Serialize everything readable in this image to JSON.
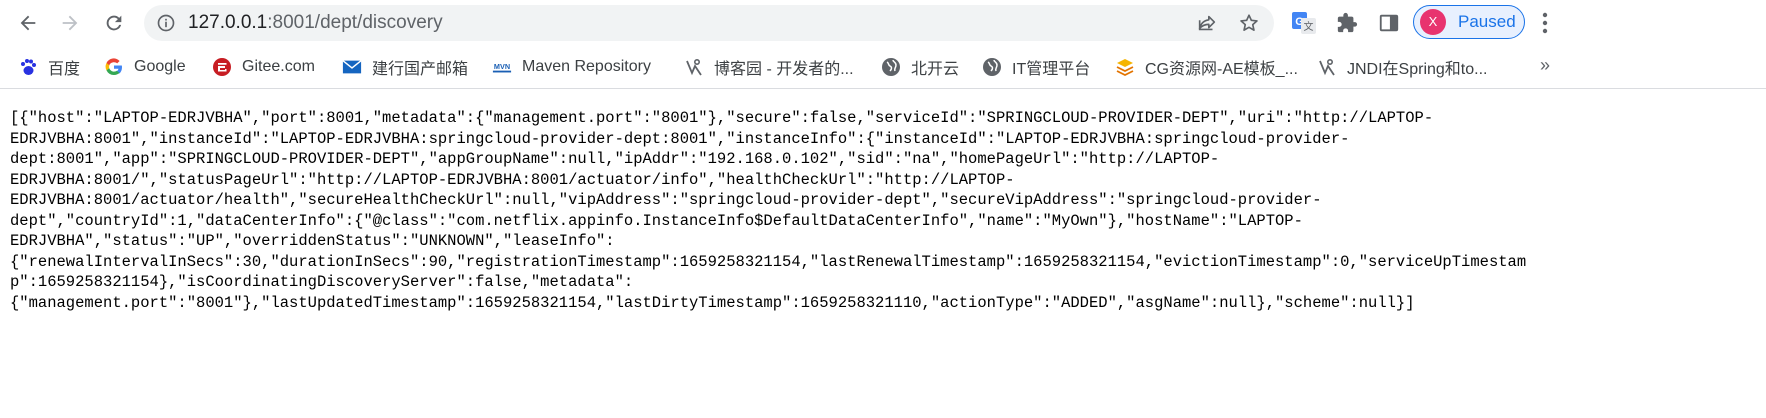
{
  "browser": {
    "url_host": "127.0.0.1",
    "url_path": ":8001/dept/discovery",
    "profile_initial": "X",
    "profile_status": "Paused",
    "colors": {
      "accent": "#1a73e8",
      "avatar": "#e8336f",
      "toolbar": "#f1f3f4"
    }
  },
  "bookmarks": {
    "items": [
      {
        "label": "百度",
        "icon": "baidu-paw-icon"
      },
      {
        "label": "Google",
        "icon": "google-g-icon"
      },
      {
        "label": "Gitee.com",
        "icon": "gitee-icon"
      },
      {
        "label": "建行国产邮箱",
        "icon": "mail-envelope-icon"
      },
      {
        "label": "Maven Repository",
        "icon": "maven-icon"
      },
      {
        "label": "博客园 - 开发者的...",
        "icon": "cnblogs-icon"
      },
      {
        "label": "北开云",
        "icon": "globe-icon"
      },
      {
        "label": "IT管理平台",
        "icon": "globe-icon"
      },
      {
        "label": "CG资源网-AE模板_...",
        "icon": "cg-icon"
      },
      {
        "label": "JNDI在Spring和to...",
        "icon": "cnblogs-icon"
      }
    ],
    "more": "»"
  },
  "page": {
    "json_text": "[{\"host\":\"LAPTOP-EDRJVBHA\",\"port\":8001,\"metadata\":{\"management.port\":\"8001\"},\"secure\":false,\"serviceId\":\"SPRINGCLOUD-PROVIDER-DEPT\",\"uri\":\"http://LAPTOP-\nEDRJVBHA:8001\",\"instanceId\":\"LAPTOP-EDRJVBHA:springcloud-provider-dept:8001\",\"instanceInfo\":{\"instanceId\":\"LAPTOP-EDRJVBHA:springcloud-provider-\ndept:8001\",\"app\":\"SPRINGCLOUD-PROVIDER-DEPT\",\"appGroupName\":null,\"ipAddr\":\"192.168.0.102\",\"sid\":\"na\",\"homePageUrl\":\"http://LAPTOP-\nEDRJVBHA:8001/\",\"statusPageUrl\":\"http://LAPTOP-EDRJVBHA:8001/actuator/info\",\"healthCheckUrl\":\"http://LAPTOP-\nEDRJVBHA:8001/actuator/health\",\"secureHealthCheckUrl\":null,\"vipAddress\":\"springcloud-provider-dept\",\"secureVipAddress\":\"springcloud-provider-\ndept\",\"countryId\":1,\"dataCenterInfo\":{\"@class\":\"com.netflix.appinfo.InstanceInfo$DefaultDataCenterInfo\",\"name\":\"MyOwn\"},\"hostName\":\"LAPTOP-\nEDRJVBHA\",\"status\":\"UP\",\"overriddenStatus\":\"UNKNOWN\",\"leaseInfo\":\n{\"renewalIntervalInSecs\":30,\"durationInSecs\":90,\"registrationTimestamp\":1659258321154,\"lastRenewalTimestamp\":1659258321154,\"evictionTimestamp\":0,\"serviceUpTimestam\np\":1659258321154},\"isCoordinatingDiscoveryServer\":false,\"metadata\":\n{\"management.port\":\"8001\"},\"lastUpdatedTimestamp\":1659258321154,\"lastDirtyTimestamp\":1659258321110,\"actionType\":\"ADDED\",\"asgName\":null},\"scheme\":null}]"
  }
}
